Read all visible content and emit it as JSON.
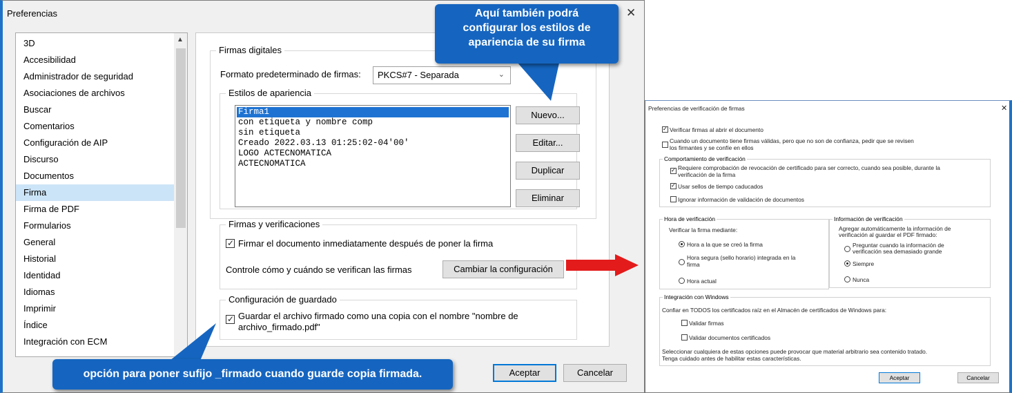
{
  "main_dialog": {
    "title": "Preferencias",
    "categories": [
      "3D",
      "Accesibilidad",
      "Administrador de seguridad",
      "Asociaciones de archivos",
      "Buscar",
      "Comentarios",
      "Configuración de AIP",
      "Discurso",
      "Documentos",
      "Firma",
      "Firma de PDF",
      "Formularios",
      "General",
      "Historial",
      "Identidad",
      "Idiomas",
      "Imprimir",
      "Índice",
      "Integración con ECM"
    ],
    "selected_category": "Firma",
    "digital_signatures": {
      "group_label": "Firmas digitales",
      "format_label": "Formato predeterminado de firmas:",
      "format_value": "PKCS#7 - Separada"
    },
    "appearance_styles": {
      "group_label": "Estilos de apariencia",
      "items": [
        "Firma1",
        "con etiqueta y nombre comp",
        "sin etiqueta",
        "Creado 2022.03.13 01:25:02-04'00'",
        "LOGO ACTECNOMATICA",
        "ACTECNOMATICA"
      ],
      "selected_item": "Firma1",
      "buttons": [
        "Nuevo...",
        "Editar...",
        "Duplicar",
        "Eliminar"
      ]
    },
    "signatures_verifications": {
      "group_label": "Firmas y verificaciones",
      "sign_after_placing": "Firmar el documento inmediatamente después de poner la firma",
      "control_text": "Controle cómo y cuándo se verifican las firmas",
      "change_button": "Cambiar la configuración"
    },
    "save_settings": {
      "group_label": "Configuración de guardado",
      "save_copy_line1": "Guardar el archivo firmado como una copia con el nombre \"nombre de",
      "save_copy_line2": "archivo_firmado.pdf\""
    },
    "ok_button": "Aceptar",
    "cancel_button": "Cancelar"
  },
  "callouts": {
    "top_line1": "Aquí también podrá",
    "top_line2": "configurar los estilos de",
    "top_line3": "apariencia de su firma",
    "bottom": "opción para poner sufijo _firmado cuando guarde copia firmada."
  },
  "verification_dialog": {
    "title": "Preferencias de verificación de firmas",
    "verify_on_open": "Verificar firmas al abrir el documento",
    "untrusted_line1": "Cuando un documento tiene firmas válidas, pero que no son de confianza, pedir que se revisen",
    "untrusted_line2": "los firmantes y se confíe en ellos",
    "behavior": {
      "group_label": "Comportamiento de verificación",
      "revocation_line1": "Requiere comprobación de revocación de certificado para ser correcto, cuando sea posible, durante la",
      "revocation_line2": "verificación de la firma",
      "expired_timestamps": "Usar sellos de tiempo caducados",
      "ignore_validation": "Ignorar información de validación de documentos"
    },
    "verification_time": {
      "group_label": "Hora de verificación",
      "verify_using": "Verificar la firma mediante:",
      "option_created": "Hora a la que se creó la firma",
      "option_secure_line1": "Hora segura (sello horario) integrada en la",
      "option_secure_line2": "firma",
      "option_current": "Hora actual"
    },
    "verification_info": {
      "group_label": "Información de verificación",
      "desc_line1": "Agregar automáticamente la información de",
      "desc_line2": "verificación al guardar el PDF firmado:",
      "option_ask_line1": "Preguntar cuando la información de",
      "option_ask_line2": "verificación sea demasiado grande",
      "option_always": "Siempre",
      "option_never": "Nunca"
    },
    "windows_integration": {
      "group_label": "Integración con Windows",
      "trust_text": "Confiar en TODOS los certificados raíz en el Almacén de certificados de Windows para:",
      "validate_signatures": "Validar firmas",
      "validate_certified": "Validar documentos certificados",
      "warning_line1": "Seleccionar cualquiera de estas opciones puede provocar que material arbitrario sea contenido tratado.",
      "warning_line2": "Tenga cuidado antes de habilitar estas características."
    },
    "ok_button": "Aceptar",
    "cancel_button": "Cancelar"
  },
  "colors": {
    "callout": "#1565c0",
    "selection": "#cce4f7",
    "list_selection": "#1e73d2",
    "arrow": "#e31b1b"
  }
}
